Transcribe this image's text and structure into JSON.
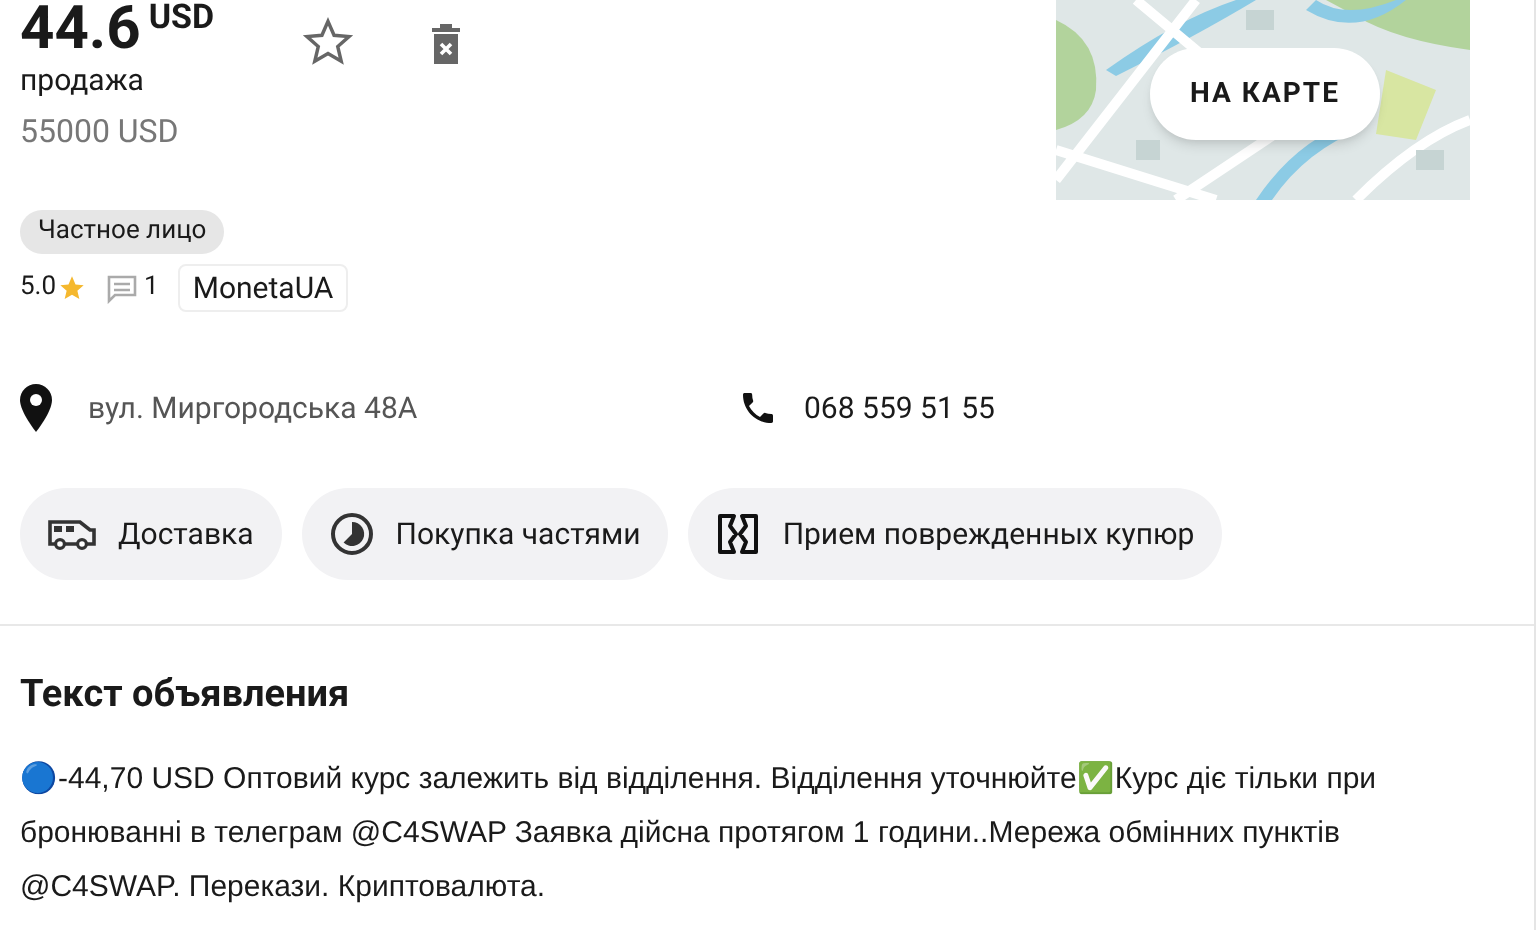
{
  "price": {
    "amount": "44.6",
    "currency": "USD",
    "deal": "продажа",
    "total": "55000 USD"
  },
  "favorite": {
    "selected": false
  },
  "map_button": "НА КАРТЕ",
  "seller": {
    "type": "Частное лицо",
    "rating": "5.0",
    "reviews": "1",
    "name": "MonetaUA"
  },
  "address": "вул. Миргородська 48А",
  "phone": "068 559 51 55",
  "features": [
    {
      "kind": "delivery",
      "label": "Доставка"
    },
    {
      "kind": "installments",
      "label": "Покупка частями"
    },
    {
      "kind": "damaged",
      "label": "Прием поврежденных купюр"
    }
  ],
  "description": {
    "title": "Текст объявления",
    "text": "🔵-44,70 USD Оптовий курс залежить від відділення. Відділення уточнюйте✅Курс діє тільки при бронюванні в телеграм @C4SWAP Заявка дійсна протягом 1 години..Мережа обмінних пунктів @C4SWAP. Перекази. Криптовалюта."
  }
}
